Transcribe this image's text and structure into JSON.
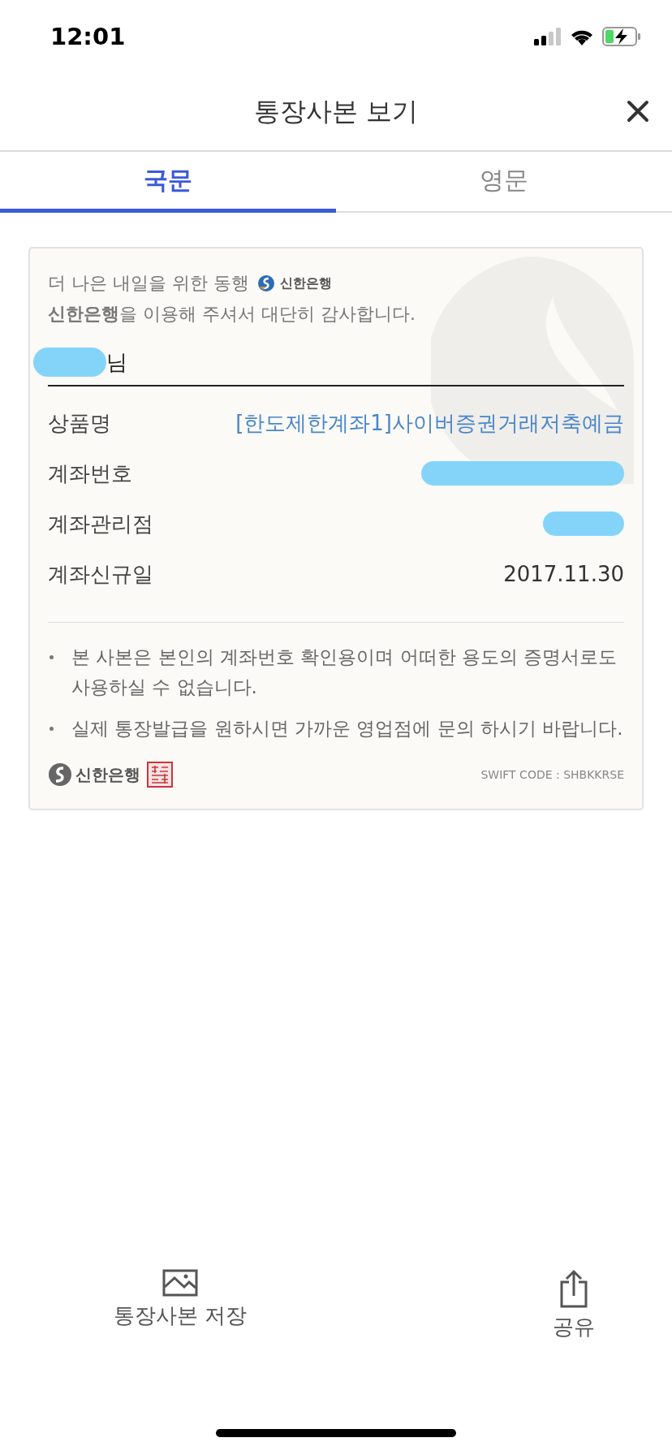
{
  "status_bar": {
    "time": "12:01"
  },
  "header": {
    "title": "통장사본 보기"
  },
  "tabs": [
    {
      "label": "국문",
      "selected": true
    },
    {
      "label": "영문",
      "selected": false
    }
  ],
  "card": {
    "slogan": "더 나은 내일을 위한 동행",
    "slogan_logo": "신한은행",
    "greeting": "**신한은행**을 이용해 주셔서 대단히 감사합니다.",
    "holder": {
      "redacted": true,
      "suffix": "님"
    },
    "rows": [
      {
        "label": "상품명",
        "kind": "highlight",
        "value": "[한도제한계좌1]사이버증권거래저축예금"
      },
      {
        "label": "계좌번호",
        "kind": "redacted_long"
      },
      {
        "label": "계좌관리점",
        "kind": "redacted_short"
      },
      {
        "label": "계좌신규일",
        "kind": "text",
        "value": "2017.11.30"
      }
    ],
    "notes": [
      "본 사본은 본인의 계좌번호 확인용이며 어떠한 용도의 증명서로도 사용하실 수 없습니다.",
      "실제 통장발급을 원하시면 가까운 영업점에 문의 하시기 바랍니다."
    ],
    "footer_logo": "신한은행",
    "swift": "SWIFT CODE : SHBKKRSE"
  },
  "actions": [
    {
      "label": "통장사본 저장",
      "kind": "image"
    },
    {
      "label": "공유",
      "kind": "share"
    }
  ]
}
